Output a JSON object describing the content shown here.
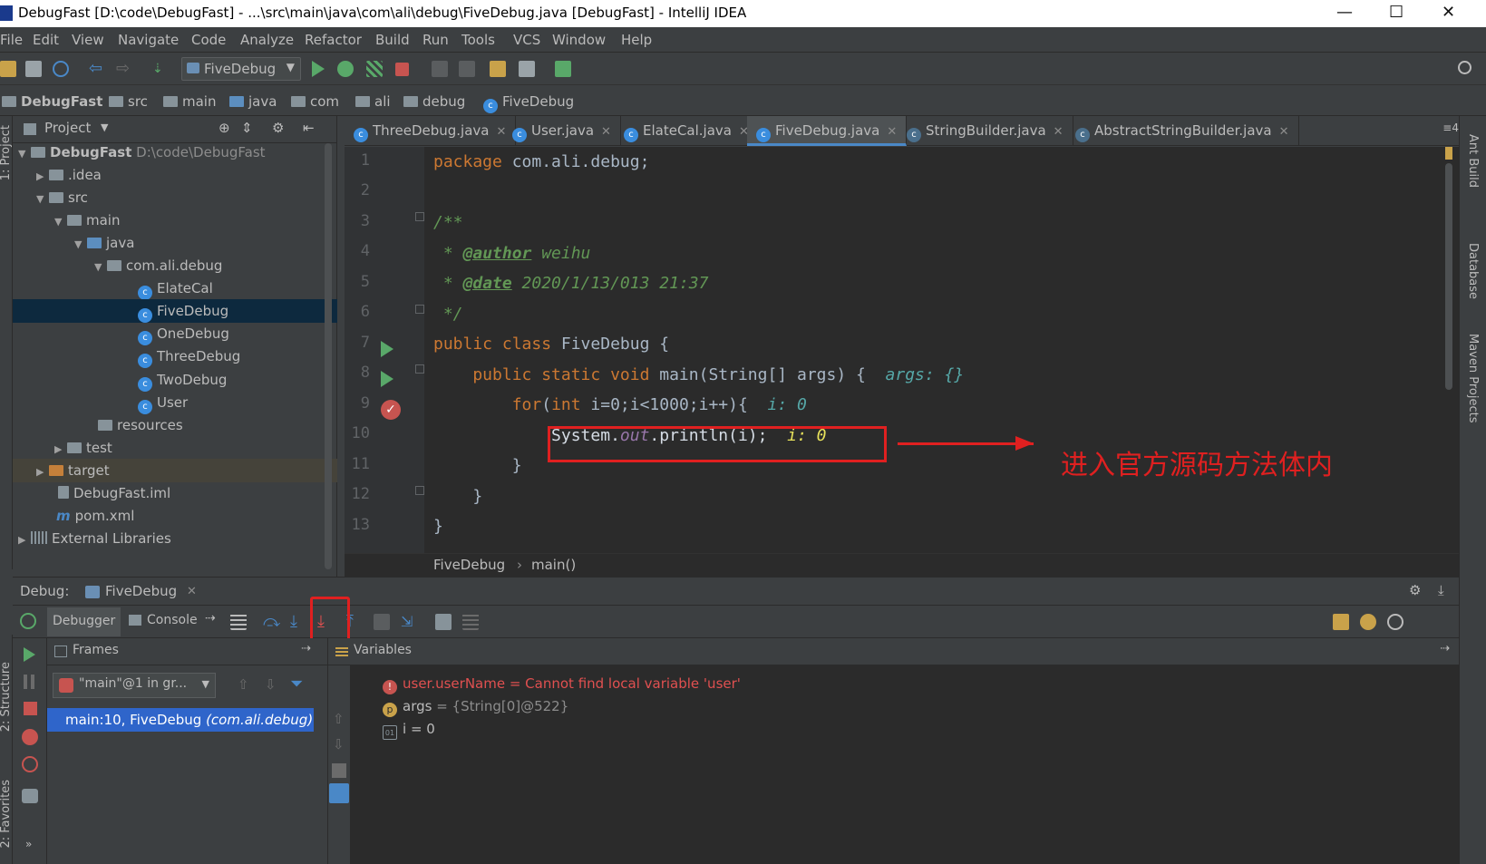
{
  "window": {
    "title": "DebugFast [D:\\code\\DebugFast] - ...\\src\\main\\java\\com\\ali\\debug\\FiveDebug.java [DebugFast] - IntelliJ IDEA",
    "minimize": "—",
    "maximize": "☐",
    "close": "✕"
  },
  "menu": [
    "File",
    "Edit",
    "View",
    "Navigate",
    "Code",
    "Analyze",
    "Refactor",
    "Build",
    "Run",
    "Tools",
    "VCS",
    "Window",
    "Help"
  ],
  "toolbar": {
    "run_config": "FiveDebug"
  },
  "breadcrumbs": [
    "DebugFast",
    "src",
    "main",
    "java",
    "com",
    "ali",
    "debug",
    "FiveDebug"
  ],
  "project": {
    "header": "Project",
    "tree": [
      {
        "label": "DebugFast",
        "extra": "D:\\code\\DebugFast"
      },
      {
        "label": ".idea"
      },
      {
        "label": "src"
      },
      {
        "label": "main"
      },
      {
        "label": "java"
      },
      {
        "label": "com.ali.debug"
      },
      {
        "label": "ElateCal"
      },
      {
        "label": "FiveDebug"
      },
      {
        "label": "OneDebug"
      },
      {
        "label": "ThreeDebug"
      },
      {
        "label": "TwoDebug"
      },
      {
        "label": "User"
      },
      {
        "label": "resources"
      },
      {
        "label": "test"
      },
      {
        "label": "target"
      },
      {
        "label": "DebugFast.iml"
      },
      {
        "label": "pom.xml"
      },
      {
        "label": "External Libraries"
      }
    ]
  },
  "tool_windows": {
    "left_project": "1: Project",
    "left_structure": "2: Structure",
    "left_favorites": "2: Favorites",
    "right_ant": "Ant Build",
    "right_database": "Database",
    "right_maven": "Maven Projects"
  },
  "editor_tabs": [
    "ThreeDebug.java",
    "User.java",
    "ElateCal.java",
    "FiveDebug.java",
    "StringBuilder.java",
    "AbstractStringBuilder.java"
  ],
  "editor_tab_count": "≡4",
  "code": {
    "line_numbers": [
      "1",
      "2",
      "3",
      "4",
      "5",
      "6",
      "7",
      "8",
      "9",
      "10",
      "11",
      "12",
      "13"
    ],
    "l1_kw": "package",
    "l1_rest": " com.ali.debug;",
    "l3": "/**",
    "l4_star": " * ",
    "l4_tag": "@author",
    "l4_val": " weihu",
    "l5_star": " * ",
    "l5_tag": "@date",
    "l5_val": " 2020/1/13/013 21:37",
    "l6": " */",
    "l7_kw": "public class",
    "l7_rest": " FiveDebug {",
    "l8_kw": "    public static void",
    "l8_rest": " main(String[] args) {",
    "l8_hint": "  args: {}",
    "l9_kw": "        for",
    "l9_a": "(",
    "l9_kw2": "int",
    "l9_b": " i=0;i<1000;i++){",
    "l9_hint": "  i: 0",
    "l10_a": "            System.",
    "l10_out": "out",
    "l10_b": ".println(i);",
    "l10_hint": "  i: 0",
    "l11": "        }",
    "l12": "    }",
    "l13": "}"
  },
  "annotation_text": "进入官方源码方法体内",
  "editor_breadcrumb": [
    "FiveDebug",
    "main()"
  ],
  "debug": {
    "label": "Debug:",
    "session": "FiveDebug",
    "tab_debugger": "Debugger",
    "tab_console": "Console",
    "frames_title": "Frames",
    "variables_title": "Variables",
    "thread": "\"main\"@1 in gr...",
    "frame": "main:10, FiveDebug",
    "frame_pkg": "(com.ali.debug)",
    "variables": [
      {
        "icon": "!",
        "text": "user.userName = Cannot find local variable 'user'"
      },
      {
        "icon": "p",
        "name": "args",
        "value": " = {String[0]@522}"
      },
      {
        "icon": "01",
        "name": "i",
        "value": " = 0"
      }
    ]
  },
  "colors": {
    "accent": "#4a88c7",
    "annotation": "#e02020",
    "current_line": "#2d5ea8",
    "breakpoint": "#c75450"
  }
}
